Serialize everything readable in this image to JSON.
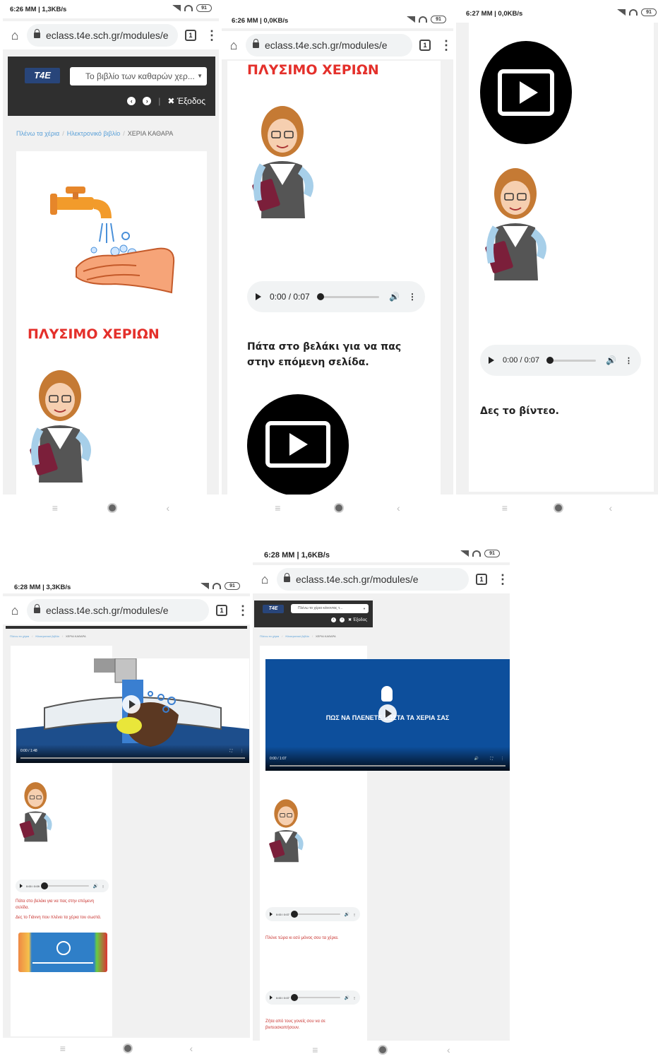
{
  "device": {
    "url": "eclass.t4e.sch.gr/modules/e",
    "tab_count": "1",
    "battery": "91"
  },
  "screens": [
    {
      "time": "6:26 ΜΜ | 1,3KB/s"
    },
    {
      "time": "6:26 ΜΜ | 0,0KB/s"
    },
    {
      "time": "6:27 ΜΜ | 0,0KB/s"
    },
    {
      "time": "6:28 ΜΜ | 3,3KB/s"
    },
    {
      "time": "6:28 ΜΜ | 1,6KB/s"
    }
  ],
  "site": {
    "logo": "T4E",
    "book_select": "Το βιβλίο των καθαρών χερ...",
    "book_select_small": "Πλένω τα χέρια κάνοντας τ...",
    "logout": "Έξοδος",
    "breadcrumb": [
      "Πλένω τα χέρια",
      "Ηλεκτρονικό βιβλίο",
      "ΧΕΡΙΑ ΚΑΘΑΡΑ"
    ]
  },
  "content": {
    "title": "ΠΛΥΣΙΜΟ ΧΕΡΙΩΝ",
    "audio_time": "0:00 / 0:07",
    "audio_time_small": "0:00 / 0:09",
    "next_page_text": "Πάτα στο βελάκι για να πας στην επόμενη σελίδα.",
    "see_video": "Δες το βίντεο.",
    "watch_giannis": "Δες το Γιάννη που πλένει τα χέρια του σωστά.",
    "wash_alone": "Πλύνε τώρα κι εσύ μόνος σου τα χέρια.",
    "ask_parents": "Ζήτα από τους γονείς σου να σε βιντεοσκοπήσουν.",
    "video1_time": "0:00 / 1:48",
    "video2_time": "0:00 / 1:07",
    "video2_title": "ΠΩΣ ΝΑ ΠΛΕΝΕΤΕ ΣΩΣΤΑ ΤΑ ΧΕΡΙΑ ΣΑΣ"
  },
  "colors": {
    "title_red": "#e4302b",
    "video_blue": "#0d4f9c",
    "header_dark": "#2f2f2f"
  }
}
